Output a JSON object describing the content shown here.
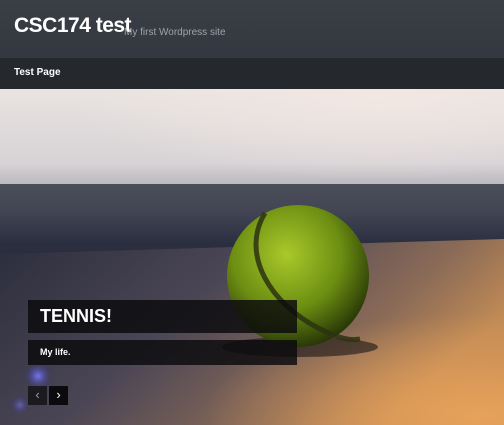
{
  "header": {
    "site_title": "CSC174 test",
    "tagline": "My first Wordpress site"
  },
  "nav": {
    "items": [
      {
        "label": "Test Page"
      }
    ]
  },
  "slider": {
    "caption_title": "TENNIS!",
    "caption_text": "My life.",
    "prev_icon": "‹",
    "next_icon": "›"
  },
  "colors": {
    "header_bg": "#363b42",
    "nav_bg": "#25292e",
    "tennis_ball": "#8fb31c"
  }
}
